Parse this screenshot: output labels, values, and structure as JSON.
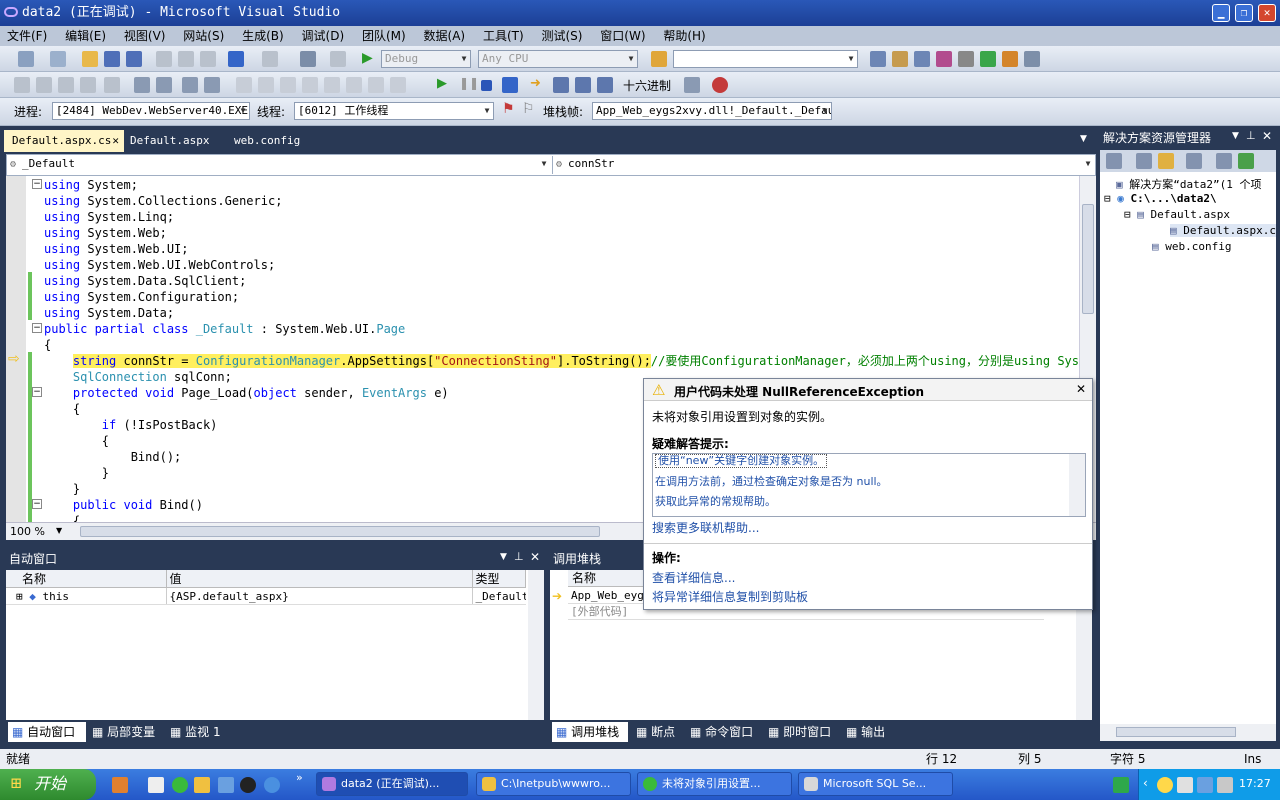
{
  "window": {
    "title": "data2 (正在调试) - Microsoft Visual Studio"
  },
  "menu": [
    "文件(F)",
    "编辑(E)",
    "视图(V)",
    "网站(S)",
    "生成(B)",
    "调试(D)",
    "团队(M)",
    "数据(A)",
    "工具(T)",
    "测试(S)",
    "窗口(W)",
    "帮助(H)"
  ],
  "toolbar1": {
    "config": "Debug",
    "platform": "Any CPU",
    "find": ""
  },
  "toolbar2": {
    "hex_label": "十六进制"
  },
  "toolbar3": {
    "process_label": "进程:",
    "process": "[2484] WebDev.WebServer40.EXE",
    "thread_label": "线程:",
    "thread": "[6012] 工作线程",
    "stack_label": "堆栈帧:",
    "stack": "App_Web_eygs2xvy.dll!_Default._Defaul"
  },
  "tabs": [
    {
      "label": "Default.aspx.cs"
    },
    {
      "label": "Default.aspx"
    },
    {
      "label": "web.config"
    }
  ],
  "nav": {
    "class": "_Default",
    "member": "connStr"
  },
  "code": [
    {
      "t": "using System;"
    },
    {
      "t": "using System.Collections.Generic;"
    },
    {
      "t": "using System.Linq;"
    },
    {
      "t": "using System.Web;"
    },
    {
      "t": "using System.Web.UI;"
    },
    {
      "t": "using System.Web.UI.WebControls;"
    },
    {
      "t": "using System.Data.SqlClient;"
    },
    {
      "t": "using System.Configuration;"
    },
    {
      "t": "using System.Data;"
    },
    {
      "t": "public partial class _Default : System.Web.UI.Page"
    },
    {
      "t": "{"
    },
    {
      "t": "    string connStr = ConfigurationManager.AppSettings[\"ConnectionSting\"].ToString();//要使用ConfigurationManager，必须加上两个using，分别是using Syste"
    },
    {
      "t": "    SqlConnection sqlConn;"
    },
    {
      "t": "    protected void Page_Load(object sender, EventArgs e)"
    },
    {
      "t": "    {"
    },
    {
      "t": "        if (!IsPostBack)"
    },
    {
      "t": "        {"
    },
    {
      "t": "            Bind();"
    },
    {
      "t": "        }"
    },
    {
      "t": "    }"
    },
    {
      "t": "    public void Bind()"
    },
    {
      "t": "    {"
    }
  ],
  "zoom": "100 %",
  "exception": {
    "title": "用户代码未处理 NullReferenceException",
    "message": "未将对象引用设置到对象的实例。",
    "tips_label": "疑难解答提示:",
    "tips": [
      "使用“new”关键字创建对象实例。",
      "在调用方法前，通过检查确定对象是否为 null。",
      "获取此异常的常规帮助。"
    ],
    "search_link": "搜索更多联机帮助...",
    "actions_label": "操作:",
    "actions": [
      "查看详细信息...",
      "将异常详细信息复制到剪贴板"
    ]
  },
  "solution": {
    "title": "解决方案资源管理器",
    "items": [
      "解决方案“data2”(1 个项",
      "C:\\...\\data2\\",
      "Default.aspx",
      "Default.aspx.c",
      "web.config"
    ]
  },
  "autos": {
    "title": "自动窗口",
    "headers": [
      "名称",
      "值",
      "类型"
    ],
    "rows": [
      {
        "name": "this",
        "value": "{ASP.default_aspx}",
        "type": "_Default"
      }
    ]
  },
  "callstack": {
    "title": "调用堆栈",
    "header": "名称",
    "rows": [
      "App_Web_eygs",
      "[外部代码]"
    ]
  },
  "bottom_tabs_left": [
    "自动窗口",
    "局部变量",
    "监视 1"
  ],
  "bottom_tabs_right": [
    "调用堆栈",
    "断点",
    "命令窗口",
    "即时窗口",
    "输出"
  ],
  "status": {
    "ready": "就绪",
    "line": "行 12",
    "col": "列 5",
    "ch": "字符 5",
    "ins": "Ins"
  },
  "taskbar": {
    "start": "开始",
    "tasks": [
      "data2 (正在调试)...",
      "C:\\Inetpub\\wwwro...",
      "未将对象引用设置...",
      "Microsoft SQL Se..."
    ],
    "clock": "17:27"
  }
}
